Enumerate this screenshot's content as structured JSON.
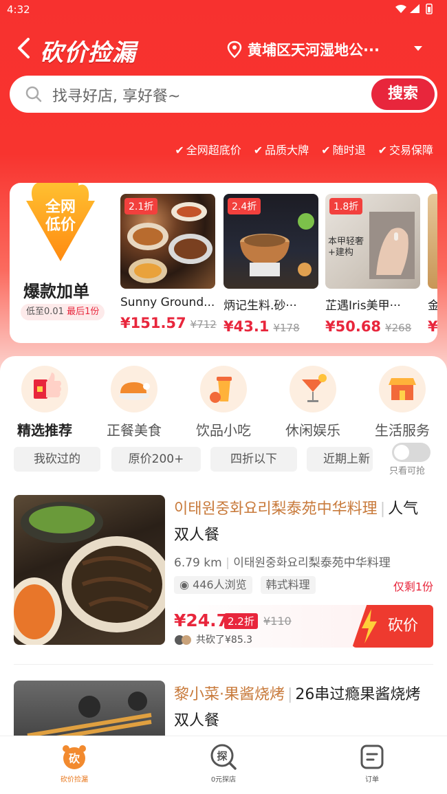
{
  "status_bar": {
    "time": "4:32"
  },
  "header": {
    "title": "砍价捡漏",
    "location": "黄埔区天河湿地公···"
  },
  "search": {
    "placeholder": "找寻好店, 享好餐~",
    "button": "搜索"
  },
  "guarantees": [
    "全网超底价",
    "品质大牌",
    "随时退",
    "交易保障"
  ],
  "promo": {
    "badge_line1": "全网",
    "badge_line2": "低价",
    "title": "爆款加单",
    "sub_prefix": "低至0.01",
    "sub_highlight": "最后1份"
  },
  "deals": [
    {
      "discount": "2.1折",
      "name": "Sunny Ground...",
      "price": "¥151.57",
      "old_price": "¥712"
    },
    {
      "discount": "2.4折",
      "name": "炳记生料.砂···",
      "price": "¥43.1",
      "old_price": "¥178"
    },
    {
      "discount": "1.8折",
      "name": "芷遇Iris美甲···",
      "price": "¥50.68",
      "old_price": "¥268"
    },
    {
      "discount": "",
      "name": "金",
      "price": "¥",
      "old_price": ""
    }
  ],
  "deal3_overlay": "本甲轻奢+建构",
  "categories": [
    {
      "label": "精选推荐",
      "icon": "thumbs-up-icon"
    },
    {
      "label": "正餐美食",
      "icon": "roast-chicken-icon"
    },
    {
      "label": "饮品小吃",
      "icon": "drink-cup-icon"
    },
    {
      "label": "休闲娱乐",
      "icon": "cocktail-icon"
    },
    {
      "label": "生活服务",
      "icon": "service-store-icon"
    }
  ],
  "filters": [
    "我砍过的",
    "原价200+",
    "四折以下",
    "近期上新"
  ],
  "toggle_label": "只看可抢",
  "items": [
    {
      "shop": "이태원중화요리梨泰苑中华料理",
      "title": "人气双人餐",
      "distance": "6.79 km",
      "branch": "이태원중화요리梨泰苑中华料理",
      "views": "446人浏览",
      "tag": "韩式料理",
      "remaining": "仅剩1份",
      "price": "¥24.7",
      "discount": "2.2折",
      "old_price": "¥110",
      "group": "共砍了¥85.3",
      "cut_button": "砍价"
    },
    {
      "shop": "黎小菜·果酱烧烤",
      "title": "26串过瘾果酱烧烤双人餐"
    }
  ],
  "nav": [
    {
      "label": "砍价捡漏",
      "icon_char": "砍"
    },
    {
      "label": "0元探店",
      "icon_char": "探"
    },
    {
      "label": "订单",
      "icon_char": ""
    }
  ],
  "colors": {
    "brand_red": "#f7312f",
    "accent_red": "#e8263c",
    "shop_brown": "#c87a3b",
    "nav_active": "#e8761a"
  }
}
